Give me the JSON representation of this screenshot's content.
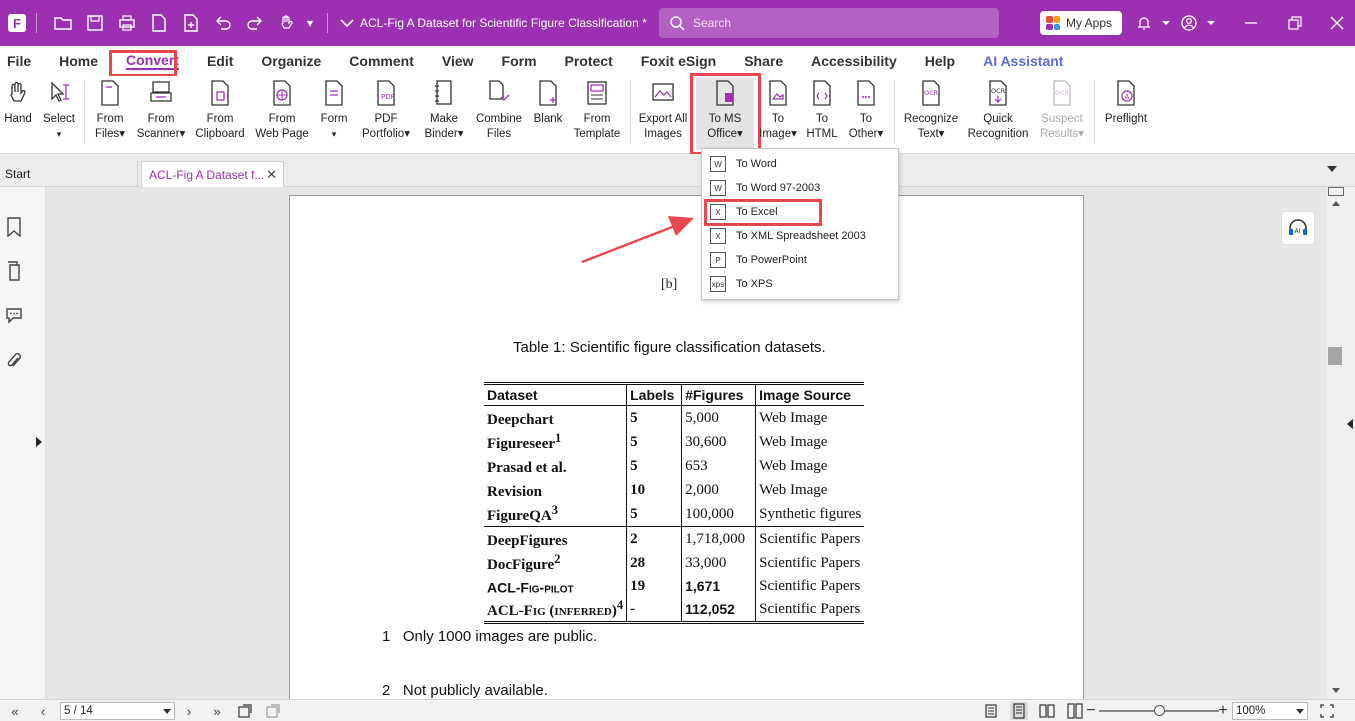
{
  "titlebar": {
    "doc_title": "ACL-Fig  A Dataset for Scientific Figure Classification *",
    "search_placeholder": "Search",
    "my_apps": "My Apps"
  },
  "menu": [
    "File",
    "Home",
    "Convert",
    "Edit",
    "Organize",
    "Comment",
    "View",
    "Form",
    "Protect",
    "Foxit eSign",
    "Share",
    "Accessibility",
    "Help",
    "AI Assistant"
  ],
  "ribbon": {
    "hand": "Hand",
    "select": "Select",
    "from_files": [
      "From",
      "Files▾"
    ],
    "from_scanner": [
      "From",
      "Scanner▾"
    ],
    "from_clipboard": [
      "From",
      "Clipboard"
    ],
    "from_webpage": [
      "From",
      "Web Page"
    ],
    "form": "Form",
    "pdf_portfolio": [
      "PDF",
      "Portfolio▾"
    ],
    "make_binder": [
      "Make",
      "Binder▾"
    ],
    "combine_files": [
      "Combine",
      "Files"
    ],
    "blank": "Blank",
    "from_template": [
      "From",
      "Template"
    ],
    "export_all_images": [
      "Export All",
      "Images"
    ],
    "to_ms_office": [
      "To MS",
      "Office▾"
    ],
    "to_image": [
      "To",
      "Image▾"
    ],
    "to_html": [
      "To",
      "HTML"
    ],
    "to_other": [
      "To",
      "Other▾"
    ],
    "recognize_text": [
      "Recognize",
      "Text▾"
    ],
    "quick_recognition": [
      "Quick",
      "Recognition"
    ],
    "suspect_results": [
      "Suspect",
      "Results▾"
    ],
    "preflight": "Preflight"
  },
  "tabs": {
    "start": "Start",
    "doc": "ACL-Fig  A Dataset f...",
    "close": "✕"
  },
  "dropdown": [
    "To Word",
    "To Word 97-2003",
    "To Excel",
    "To XML Spreadsheet 2003",
    "To PowerPoint",
    "To XPS"
  ],
  "document": {
    "label_b": "[b]",
    "caption": "Table 1: Scientific figure classification datasets.",
    "headers": [
      "Dataset",
      "Labels",
      "#Figures",
      "Image Source"
    ],
    "rows": [
      [
        "Deepchart",
        "",
        "5",
        "5,000",
        "Web Image"
      ],
      [
        "Figureseer",
        "1",
        "5",
        "30,600",
        "Web Image"
      ],
      [
        "Prasad et al.",
        "",
        "5",
        "653",
        "Web Image"
      ],
      [
        "Revision",
        "",
        "10",
        "2,000",
        "Web Image"
      ],
      [
        "FigureQA",
        "3",
        "5",
        "100,000",
        "Synthetic figures"
      ],
      [
        "DeepFigures",
        "",
        "2",
        "1,718,000",
        "Scientific Papers"
      ],
      [
        "DocFigure",
        "2",
        "28",
        "33,000",
        "Scientific Papers"
      ],
      [
        "ACL-Fig-pilot",
        "",
        "19",
        "1,671",
        "Scientific Papers"
      ],
      [
        "ACL-Fig (inferred)",
        "4",
        "-",
        "112,052",
        "Scientific Papers"
      ]
    ],
    "footnotes": [
      {
        "num": "1",
        "text": "Only 1000 images are public."
      },
      {
        "num": "2",
        "text": "Not publicly available."
      }
    ]
  },
  "status": {
    "page": "5 / 14",
    "zoom": "100%"
  },
  "colors": {
    "brand": "#9b30b0",
    "highlight": "#e8474f"
  }
}
